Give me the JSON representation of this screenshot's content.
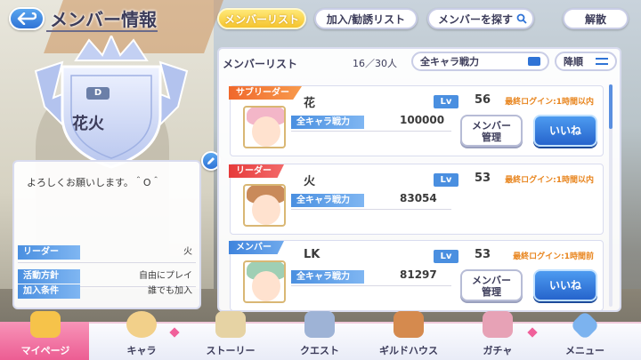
{
  "header": {
    "back_label": "",
    "title": "メンバー情報",
    "tabs": [
      {
        "label": "メンバーリスト",
        "active": true
      },
      {
        "label": "加入/勧誘リスト",
        "active": false
      },
      {
        "label": "メンバーを探す",
        "active": false
      }
    ],
    "disband_label": "解散"
  },
  "emblem": {
    "rank": "D",
    "clan_name": "花火"
  },
  "profile": {
    "comment": "よろしくお願いします。＾O＾",
    "rows": [
      {
        "label": "リーダー",
        "value": "火"
      },
      {
        "label": "活動方針",
        "value": "自由にプレイ"
      },
      {
        "label": "加入条件",
        "value": "誰でも加入"
      }
    ]
  },
  "member_list": {
    "title": "メンバーリスト",
    "count": "16／30人",
    "filter_label": "全キャラ戦力",
    "sort_label": "降順",
    "power_label": "全キャラ戦力",
    "lv_label": "Lv",
    "manage_label": "メンバー\n管理",
    "like_label": "いいね",
    "members": [
      {
        "role": "サブリーダー",
        "name": "花",
        "level": "56",
        "power": "100000",
        "login": "最終ログイン:1時間以内"
      },
      {
        "role": "リーダー",
        "name": "火",
        "level": "53",
        "power": "83054",
        "login": "最終ログイン:1時間以内"
      },
      {
        "role": "メンバー",
        "name": "LK",
        "level": "53",
        "power": "81297",
        "login": "最終ログイン:1時間前"
      }
    ]
  },
  "nav": {
    "items": [
      {
        "label": "マイページ",
        "active": true
      },
      {
        "label": "キャラ",
        "active": false
      },
      {
        "label": "ストーリー",
        "active": false
      },
      {
        "label": "クエスト",
        "active": false
      },
      {
        "label": "ギルドハウス",
        "active": false
      },
      {
        "label": "ガチャ",
        "active": false
      },
      {
        "label": "メニュー",
        "active": false
      }
    ]
  },
  "colors": {
    "accent_blue": "#2f73d6",
    "accent_pink": "#ec5d93",
    "tab_active": "#f5c42e",
    "login_orange": "#e8851e"
  }
}
